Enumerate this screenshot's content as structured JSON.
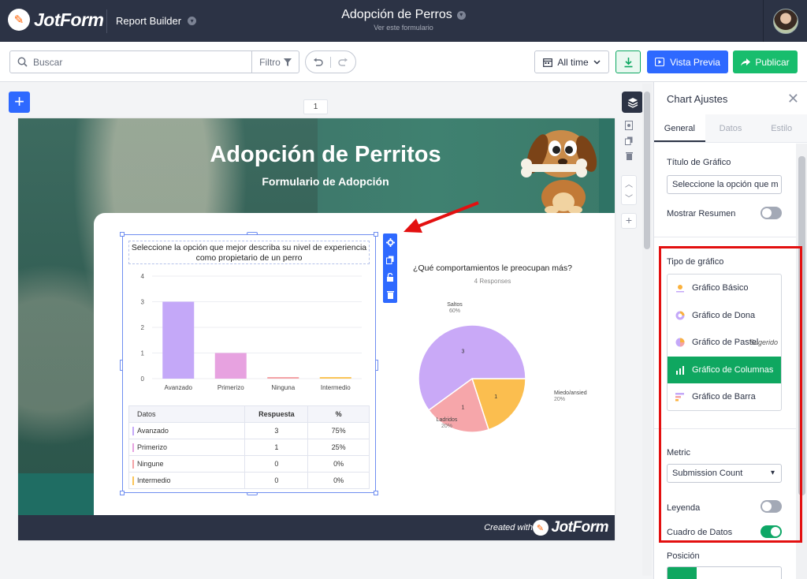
{
  "app": {
    "logo_text": "JotForm",
    "section": "Report Builder",
    "title": "Adopción de Perros",
    "subtitle": "Ver este formulario"
  },
  "toolbar": {
    "search_placeholder": "Buscar",
    "filter_label": "Filtro",
    "time_range": "All time",
    "preview_label": "Vista Previa",
    "publish_label": "Publicar"
  },
  "canvas": {
    "page_number": "1"
  },
  "report": {
    "banner_title": "Adopción de Perritos",
    "banner_subtitle": "Formulario de Adopción",
    "footer_created": "Created with",
    "footer_logo": "JotForm"
  },
  "bar_widget": {
    "title": "Seleccione la opción que mejor describa su nivel de experiencia como propietario de un perro",
    "table_headers": [
      "Datos",
      "Respuesta",
      "%"
    ],
    "rows": [
      {
        "label": "Avanzado",
        "count": "3",
        "pct": "75%",
        "color": "#c4a8f8"
      },
      {
        "label": "Primerizo",
        "count": "1",
        "pct": "25%",
        "color": "#e7a2e0"
      },
      {
        "label": "Ningune",
        "count": "0",
        "pct": "0%",
        "color": "#f4a3a6"
      },
      {
        "label": "Intermedio",
        "count": "0",
        "pct": "0%",
        "color": "#fbc558"
      }
    ]
  },
  "pie_widget": {
    "title": "¿Qué comportamientos le preocupan más?",
    "responses": "4 Responses"
  },
  "chart_data": [
    {
      "type": "bar",
      "categories": [
        "Avanzado",
        "Primerizo",
        "Ninguna",
        "Intermedio"
      ],
      "values": [
        3,
        1,
        0,
        0
      ],
      "colors": [
        "#c4a8f8",
        "#e7a2e0",
        "#f4a3a6",
        "#fbc558"
      ],
      "ylim": [
        0,
        4
      ],
      "yticks": [
        0,
        1,
        2,
        3,
        4
      ],
      "grid": true
    },
    {
      "type": "pie",
      "labels": [
        "Saltos",
        "Miedo/ansiedad",
        "Ladridos"
      ],
      "values": [
        3,
        1,
        1
      ],
      "percent_labels": [
        "60%",
        "20%",
        "20%"
      ],
      "colors": [
        "#c9a9f7",
        "#fbbe4f",
        "#f6a6aa"
      ]
    }
  ],
  "panel": {
    "title": "Chart Ajustes",
    "tabs": [
      "General",
      "Datos",
      "Estilo"
    ],
    "titulo_label": "Título de Gráfico",
    "titulo_value": "Seleccione la opción que m",
    "mostrar_resumen_label": "Mostrar Resumen",
    "mostrar_resumen": false,
    "tipo_label": "Tipo de gráfico",
    "types": [
      {
        "label": "Gráfico Básico",
        "icon": "basic-chart-icon"
      },
      {
        "label": "Gráfico de Dona",
        "icon": "donut-chart-icon"
      },
      {
        "label": "Gráfico de Pastel",
        "icon": "pie-chart-icon",
        "badge": "Sugerido"
      },
      {
        "label": "Gráfico de Columnas",
        "icon": "column-chart-icon",
        "selected": true
      },
      {
        "label": "Gráfico de Barra",
        "icon": "bar-chart-icon"
      }
    ],
    "metric_label": "Metric",
    "metric_value": "Submission Count",
    "leyenda_label": "Leyenda",
    "leyenda": false,
    "cuadro_label": "Cuadro de Datos",
    "cuadro": true,
    "posicion_label": "Posición"
  },
  "colors": {
    "topbar": "#2c3345",
    "primary_blue": "#2e69ff",
    "green": "#18bd6d",
    "highlight_red": "#e31010"
  }
}
